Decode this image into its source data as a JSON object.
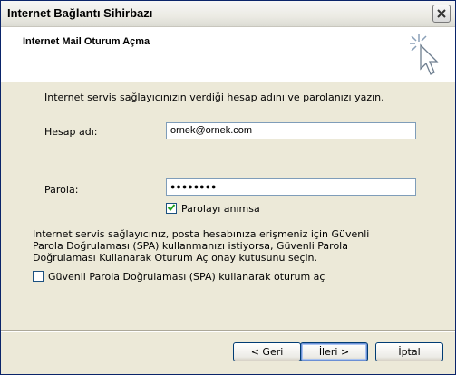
{
  "window": {
    "title": "Internet Bağlantı Sihirbazı"
  },
  "header": {
    "title": "Internet Mail Oturum Açma"
  },
  "content": {
    "intro": "Internet servis sağlayıcınızın verdiği hesap adını ve parolanızı yazın.",
    "account_label": "Hesap adı:",
    "account_value": "ornek@ornek.com",
    "password_label": "Parola:",
    "password_masked": "●●●●●●●●",
    "remember_label": "Parolayı anımsa",
    "remember_checked": true,
    "spa_text": "Internet servis sağlayıcınız, posta hesabınıza erişmeniz için Güvenli Parola Doğrulaması (SPA) kullanmanızı istiyorsa, Güvenli Parola Doğrulaması Kullanarak Oturum Aç onay kutusunu seçin.",
    "spa_label": "Güvenli Parola Doğrulaması (SPA) kullanarak oturum aç",
    "spa_checked": false
  },
  "buttons": {
    "back": "< Geri",
    "next": "İleri >",
    "cancel": "İptal"
  }
}
